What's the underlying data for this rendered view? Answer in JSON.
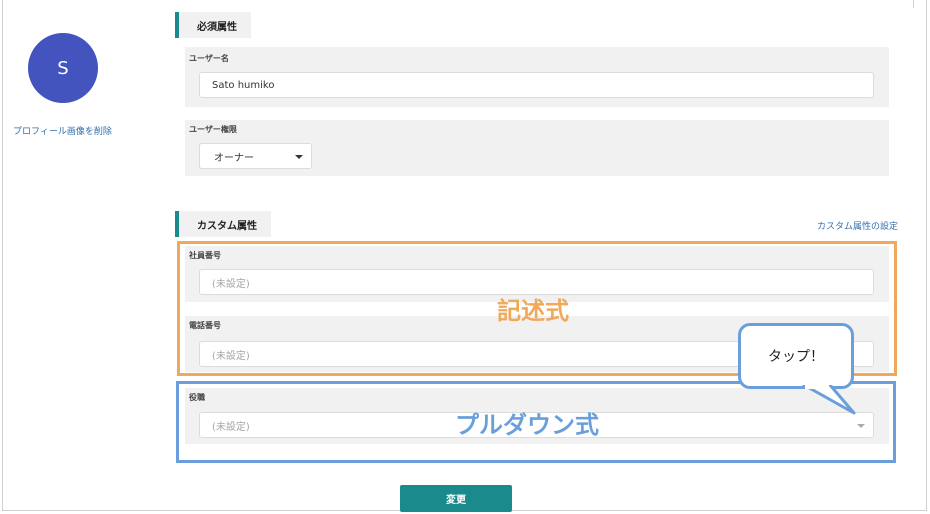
{
  "avatar": {
    "initial": "S",
    "remove_label": "プロフィール画像を削除"
  },
  "required_section": {
    "title": "必須属性",
    "username": {
      "label": "ユーザー名",
      "value": "Sato humiko"
    },
    "permission": {
      "label": "ユーザー権限",
      "selected": "オーナー"
    }
  },
  "custom_section": {
    "title": "カスタム属性",
    "settings_link": "カスタム属性の設定",
    "employee_no": {
      "label": "社員番号",
      "placeholder": "(未設定)"
    },
    "phone": {
      "label": "電話番号",
      "placeholder": "(未設定)"
    },
    "position": {
      "label": "役職",
      "placeholder": "(未設定)"
    }
  },
  "annotations": {
    "text_type": "記述式",
    "dropdown_type": "プルダウン式",
    "bubble": "タップ！"
  },
  "submit_label": "変更",
  "colors": {
    "accent": "#1b8a8c",
    "avatar": "#4454be",
    "link": "#2f6fb0",
    "orange_annotation": "#f0a95a",
    "blue_annotation": "#6a9fdb"
  }
}
